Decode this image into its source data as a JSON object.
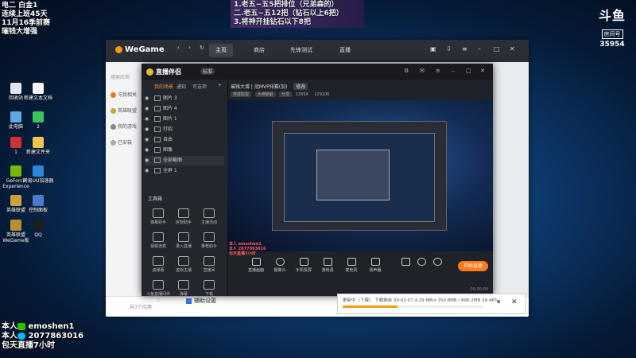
{
  "overlay": {
    "top_left": [
      "电二 白金1",
      "连续上班45天",
      "11月16季前赛",
      "璀钱大增强"
    ],
    "top_center": [
      "1.老五~五5把排位（兄弟森的）",
      "二.老五~五12把（钻石以上6把）",
      "3.将神开挂钻石以下8把"
    ],
    "douyu": {
      "logo": "斗鱼",
      "sub": "房间号",
      "room": "35954"
    },
    "bottom_left": {
      "line1_prefix": "本人",
      "line1_value": "emoshen1",
      "line2_prefix": "本人",
      "line2_value": "2077863016",
      "line3": "包天直播7小时"
    }
  },
  "desktop_icons": [
    {
      "label": "回收站"
    },
    {
      "label": "新建文本文档"
    },
    {
      "label": "此电脑"
    },
    {
      "label": "2"
    },
    {
      "label": "1"
    },
    {
      "label": "新建文件夹"
    },
    {
      "label": "GeForce Experience"
    },
    {
      "label": "网易UU加速器"
    },
    {
      "label": "英雄联盟"
    },
    {
      "label": "控制面板"
    },
    {
      "label": "英雄联盟 WeGame版"
    },
    {
      "label": "QQ"
    }
  ],
  "wegame": {
    "logo": "WeGame",
    "tabs": [
      "主页",
      "商店",
      "先锋测试",
      "直播"
    ],
    "sidebar": [
      "与我相关",
      "英雄联盟",
      "我的游戏",
      "已安装"
    ],
    "search_placeholder": "搜索应用",
    "bottom_left": "共3个应用",
    "assist_label": "辅助设置"
  },
  "live": {
    "title": "直播伴侣",
    "badge": "标准",
    "subtabs": [
      "我的场景",
      "通知",
      "可选项"
    ],
    "scenes": [
      "图片 3",
      "图片 4",
      "图片 1",
      "打招",
      "自由",
      "图像",
      "全部截图",
      "全屏 1"
    ],
    "tools_title": "工具箱",
    "tools": [
      "弹幕助手",
      "房管助手",
      "主播活动",
      "视频连麦",
      "录入直播",
      "推荐助手",
      "虚弹幕",
      "虚拟主播",
      "直播间",
      "斗鱼直播间伴侣",
      "弹幕",
      "下载"
    ],
    "room_title": "璀钱大增 | 冠MVP排赛(加)",
    "room_tag": "修改",
    "room_pills": [
      "英雄联盟",
      "大神破解",
      "分享",
      "13554",
      "129106"
    ],
    "chat_lines": [
      "本人 emoshen1",
      "本人 2077863016",
      "包天直播7小时"
    ],
    "toolbar": [
      "直播画面",
      "摄像头",
      "手机投屏",
      "游戏源",
      "麦克风",
      "扬声器"
    ],
    "start_button": "开始直播",
    "status_left": "",
    "status_right": "00:00:00"
  },
  "download": {
    "text": "更新中（下载） 下载剩余 00:02:07  4.29 MB/s  350.8MB / 896.2MB  39.46%",
    "progress": 0.39,
    "pause": "⏸",
    "close": "✕"
  }
}
